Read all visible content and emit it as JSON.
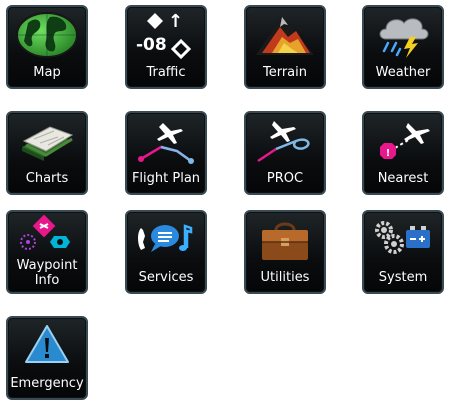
{
  "tiles": [
    {
      "id": "map",
      "label": "Map",
      "icon": "globe-icon"
    },
    {
      "id": "traffic",
      "label": "Traffic",
      "icon": "traffic-icon",
      "altitude": "-08",
      "arrow": "↑"
    },
    {
      "id": "terrain",
      "label": "Terrain",
      "icon": "mountain-icon"
    },
    {
      "id": "weather",
      "label": "Weather",
      "icon": "storm-cloud-icon"
    },
    {
      "id": "charts",
      "label": "Charts",
      "icon": "charts-icon"
    },
    {
      "id": "flight-plan",
      "label": "Flight Plan",
      "icon": "flight-plan-icon"
    },
    {
      "id": "proc",
      "label": "PROC",
      "icon": "procedure-icon"
    },
    {
      "id": "nearest",
      "label": "Nearest",
      "icon": "nearest-icon"
    },
    {
      "id": "waypoint-info",
      "label_line1": "Waypoint",
      "label_line2": "Info",
      "icon": "waypoint-icon"
    },
    {
      "id": "services",
      "label": "Services",
      "icon": "services-icon"
    },
    {
      "id": "utilities",
      "label": "Utilities",
      "icon": "toolbox-icon"
    },
    {
      "id": "system",
      "label": "System",
      "icon": "gears-battery-icon"
    },
    {
      "id": "emergency",
      "label": "Emergency",
      "icon": "warning-triangle-icon"
    }
  ],
  "colors": {
    "tile_border": "#3a4a52",
    "magenta": "#e8188c",
    "cyan": "#00b4d8"
  }
}
